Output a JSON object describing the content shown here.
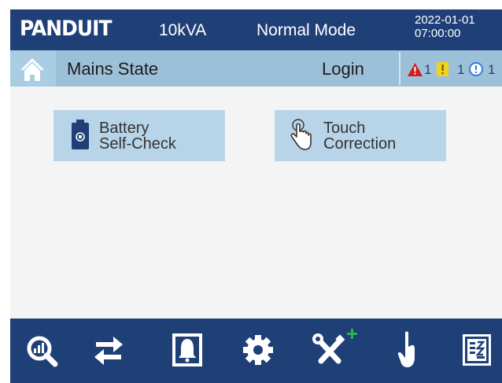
{
  "header": {
    "brand": "PANDUIT",
    "capacity": "10kVA",
    "mode": "Normal Mode",
    "date": "2022-01-01",
    "time": "07:00:00"
  },
  "status_bar": {
    "home_icon": "home-icon",
    "state_label": "Mains State",
    "login_label": "Login",
    "alarms": [
      {
        "icon": "critical-alarm-icon",
        "color": "#d41c1c",
        "count": "1"
      },
      {
        "icon": "warning-alarm-icon",
        "color": "#f2d21b",
        "count": "1"
      },
      {
        "icon": "info-alarm-icon",
        "color": "#2f7de0",
        "count": "1"
      }
    ]
  },
  "tiles": [
    {
      "icon": "battery-icon",
      "label": "Battery\nSelf-Check"
    },
    {
      "icon": "touch-hand-icon",
      "label": "Touch\nCorrection"
    }
  ],
  "nav": [
    {
      "icon": "magnifier-icon"
    },
    {
      "icon": "transfer-arrows-icon"
    },
    {
      "icon": "alarm-bell-icon"
    },
    {
      "icon": "gear-icon"
    },
    {
      "icon": "tools-plus-icon"
    },
    {
      "icon": "hand-pointer-icon"
    },
    {
      "icon": "log-document-icon"
    }
  ],
  "colors": {
    "header_bg": "#1f3f77",
    "status_bar_bg": "#9dc0d9",
    "tile_bg": "#b8d4e8",
    "content_bg": "#f4f4f4",
    "plus_accent": "#2db34a"
  }
}
